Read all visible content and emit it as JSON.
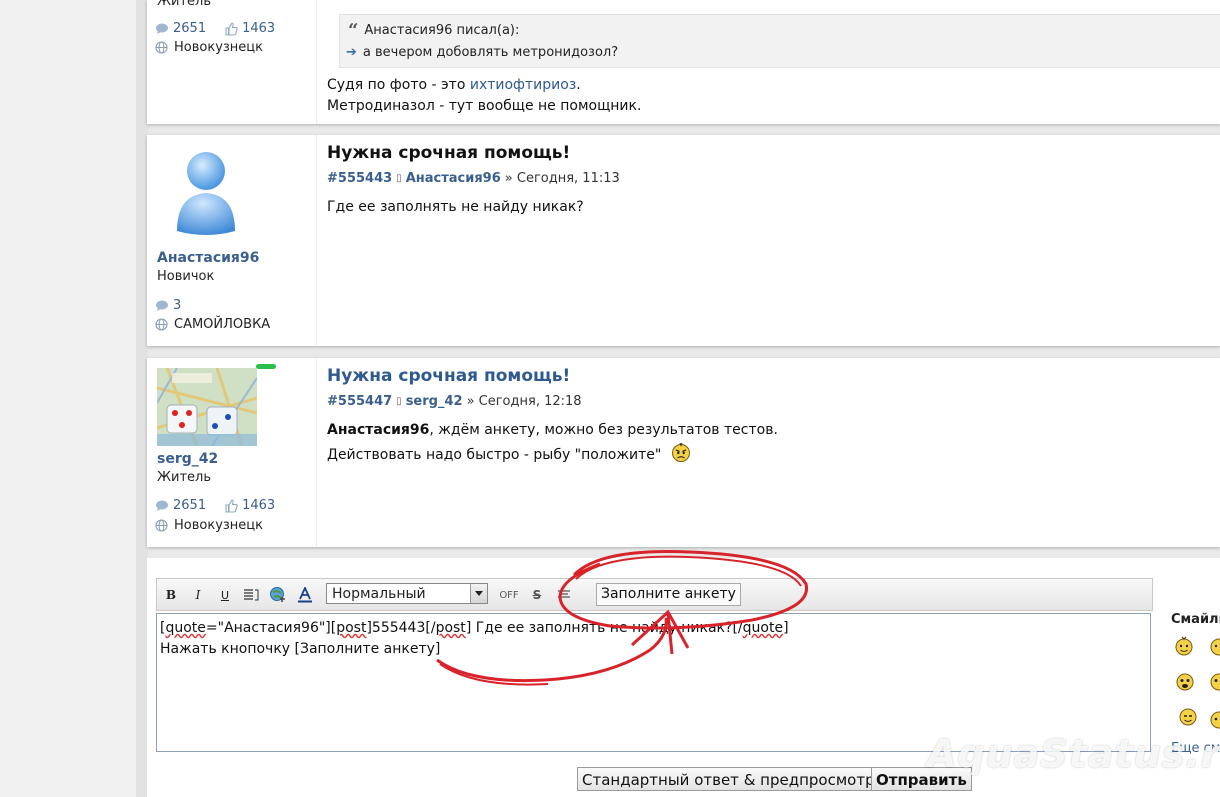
{
  "post1": {
    "user_rank": "Житель",
    "posts": "2651",
    "likes": "1463",
    "location": "Новокузнецк",
    "quote_author": "Анастасия96 писал(а):",
    "quote_text": "а вечером добовлять метронидозол?",
    "text1_prefix": "Судя по фото - это ",
    "text1_link": "ихтиофтириоз",
    "text1_suffix": ".",
    "text2": "Метродиназол - тут вообще не помощник."
  },
  "post2": {
    "user_name": "Анастасия96",
    "user_rank": "Новичок",
    "posts": "3",
    "location": "САМОЙЛОВКА",
    "title": "Нужна срочная помощь!",
    "post_num": "#555443",
    "author": "Анастасия96",
    "date": "» Сегодня, 11:13",
    "text": "Где ее заполнять не найду никак?"
  },
  "post3": {
    "user_name": "serg_42",
    "user_rank": "Житель",
    "posts": "2651",
    "likes": "1463",
    "location": "Новокузнецк",
    "title": "Нужна срочная помощь!",
    "post_num": "#555447",
    "author": "serg_42",
    "date": "» Сегодня, 12:18",
    "text1_name": "Анастасия96",
    "text1_rest": ", ждём анкету, можно без результатов тестов.",
    "text2": "Действовать надо быстро - рыбу \"положите\""
  },
  "editor": {
    "font_select": "Нормальный",
    "anketa_button": "Заполните анкету",
    "line1_a": "[",
    "line1_b": "quote",
    "line1_c": "=\"Анастасия96\"][",
    "line1_d": "post",
    "line1_e": "]555443[/",
    "line1_f": "post",
    "line1_g": "] Где ее заполнять не найду никак?[/",
    "line1_h": "quote",
    "line1_i": "]",
    "line2": "Нажать кнопочку [Заполните анкету]",
    "smileys_title": "Смайлы",
    "more_smileys": "Еще смайлы",
    "preview_button": "Стандартный ответ & предпросмотр",
    "submit_button": "Отправить"
  },
  "watermark": "AquaStatus.ru",
  "colors": {
    "link": "#2f5a8e",
    "annotation": "#d8232a",
    "online": "#27c04a"
  }
}
